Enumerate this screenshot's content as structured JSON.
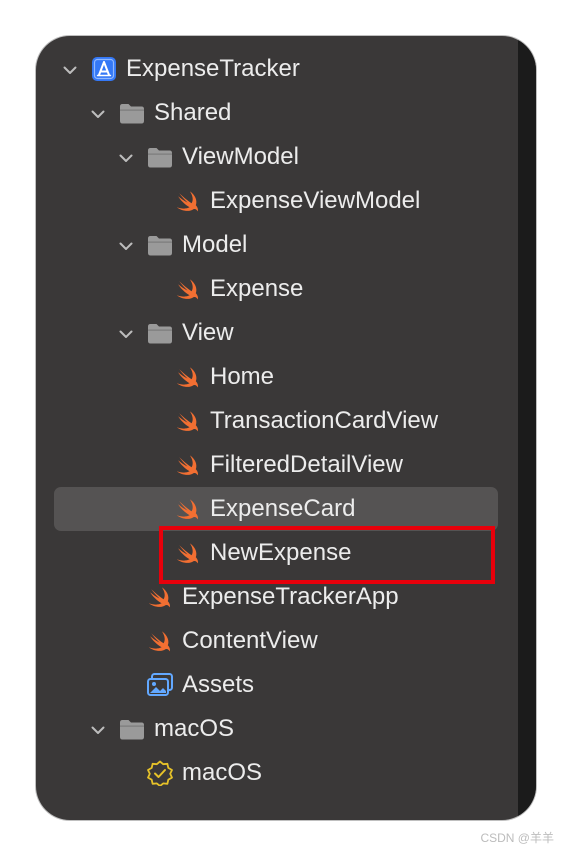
{
  "navigator": {
    "items": [
      {
        "label": "ExpenseTracker",
        "icon": "xcode-project-icon",
        "level": 0,
        "disclosure": "expanded"
      },
      {
        "label": "Shared",
        "icon": "folder-icon",
        "level": 1,
        "disclosure": "expanded"
      },
      {
        "label": "ViewModel",
        "icon": "folder-icon",
        "level": 2,
        "disclosure": "expanded"
      },
      {
        "label": "ExpenseViewModel",
        "icon": "swift-file-icon",
        "level": 3,
        "disclosure": "none"
      },
      {
        "label": "Model",
        "icon": "folder-icon",
        "level": 2,
        "disclosure": "expanded"
      },
      {
        "label": "Expense",
        "icon": "swift-file-icon",
        "level": 3,
        "disclosure": "none"
      },
      {
        "label": "View",
        "icon": "folder-icon",
        "level": 2,
        "disclosure": "expanded"
      },
      {
        "label": "Home",
        "icon": "swift-file-icon",
        "level": 3,
        "disclosure": "none"
      },
      {
        "label": "TransactionCardView",
        "icon": "swift-file-icon",
        "level": 3,
        "disclosure": "none"
      },
      {
        "label": "FilteredDetailView",
        "icon": "swift-file-icon",
        "level": 3,
        "disclosure": "none"
      },
      {
        "label": "ExpenseCard",
        "icon": "swift-file-icon",
        "level": 3,
        "disclosure": "none",
        "selected": true
      },
      {
        "label": "NewExpense",
        "icon": "swift-file-icon",
        "level": 3,
        "disclosure": "none",
        "highlighted": true
      },
      {
        "label": "ExpenseTrackerApp",
        "icon": "swift-file-icon",
        "level": 2,
        "disclosure": "none"
      },
      {
        "label": "ContentView",
        "icon": "swift-file-icon",
        "level": 2,
        "disclosure": "none"
      },
      {
        "label": "Assets",
        "icon": "asset-catalog-icon",
        "level": 2,
        "disclosure": "none"
      },
      {
        "label": "macOS",
        "icon": "folder-icon",
        "level": 1,
        "disclosure": "expanded"
      },
      {
        "label": "macOS",
        "icon": "entitlements-badge-icon",
        "level": 2,
        "disclosure": "none"
      }
    ]
  },
  "colors": {
    "panel_background": "#3a3838",
    "selection": "#555353",
    "annotation_box": "#e8000b",
    "swift_orange": "#f26f32",
    "folder_gray": "#9a9a9a",
    "text": "#ececec"
  },
  "watermark": "CSDN @羊羊"
}
